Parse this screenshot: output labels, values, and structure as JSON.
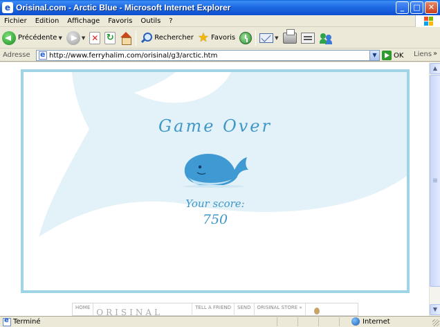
{
  "window": {
    "title": "Orisinal.com - Arctic Blue - Microsoft Internet Explorer",
    "minimize": "_",
    "maximize": "□",
    "close": "✕"
  },
  "menu": [
    "Fichier",
    "Edition",
    "Affichage",
    "Favoris",
    "Outils",
    "?"
  ],
  "toolbar": {
    "back_label": "Précédente",
    "search_label": "Rechercher",
    "favorites_label": "Favoris"
  },
  "address": {
    "label": "Adresse",
    "url": "http://www.ferryhalim.com/orisinal/g3/arctic.htm",
    "go_label": "OK",
    "links_label": "Liens"
  },
  "game": {
    "title": "Game Over",
    "score_label": "Your score:",
    "score_value": "750"
  },
  "banner": {
    "home": "HOME",
    "logo": "ORISINAL",
    "tell": "TELL A FRIEND",
    "send": "SEND",
    "store": "ORISINAL STORE »"
  },
  "status": {
    "text": "Terminé",
    "zone": "Internet"
  },
  "colors": {
    "game_text": "#3f97c9",
    "frame_border": "#9fd4e6",
    "whale_shadow": "#e3f1f8"
  }
}
